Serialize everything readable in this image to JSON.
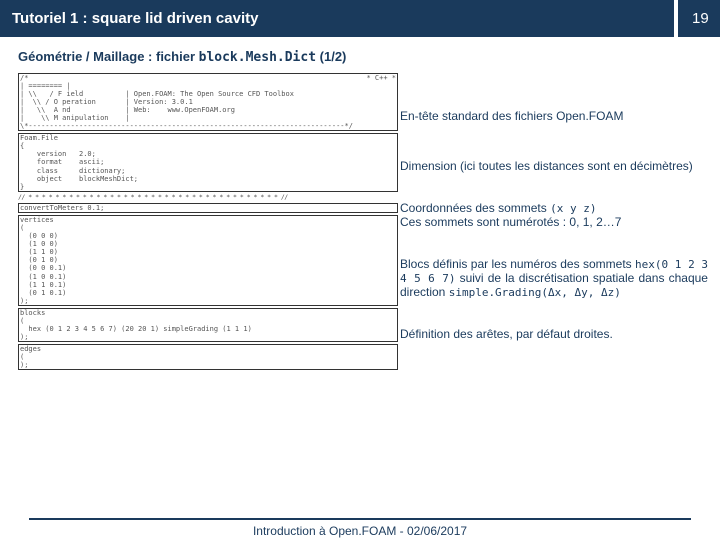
{
  "header": {
    "title": "Tutoriel 1 : square lid driven cavity",
    "page": "19"
  },
  "subtitle": {
    "prefix": "Géométrie / Maillage : fichier ",
    "code": "block.Mesh.Dict",
    "suffix": " (1/2)"
  },
  "code": {
    "topbar_left": "/*",
    "topbar_right": "* C++ *",
    "banner": "| ======== |\n| \\\\   / F ield          | Open.FOAM: The Open Source CFD Toolbox\n|  \\\\ / O peration       | Version: 3.0.1\n|   \\\\  A nd             | Web:    www.OpenFOAM.org\n|    \\\\ M anipulation    |\n\\*---------------------------------------------------------------------------*/",
    "foamfile": "Foam.File\n{\n    version   2.0;\n    format    ascii;\n    class     dictionary;\n    object    blockMeshDict;\n}",
    "stars_line": "// * * * * * * * * * * * * * * * * * * * * * * * * * * * * * * * * * * * * * //",
    "convert": "convertToMeters 0.1;",
    "vertices": "vertices\n(\n  (0 0 0)\n  (1 0 0)\n  (1 1 0)\n  (0 1 0)\n  (0 0 0.1)\n  (1 0 0.1)\n  (1 1 0.1)\n  (0 1 0.1)\n);",
    "blocks": "blocks\n(\n  hex (0 1 2 3 4 5 6 7) (20 20 1) simpleGrading (1 1 1)\n);",
    "edges": "edges\n(\n);"
  },
  "comments": {
    "c1": "En-tête standard des fichiers Open.FOAM",
    "c2": "Dimension (ici toutes les distances sont en décimètres)",
    "c3_a": "Coordonnées des sommets ",
    "c3_code": "(x y z)",
    "c3_b": "Ces sommets sont numérotés : 0, 1, 2…7",
    "c4_a": "Blocs définis par les numéros des sommets ",
    "c4_code1": "hex(0 1 2 3 4 5 6 7)",
    "c4_b": " suivi de la discrétisation spatiale dans chaque direction ",
    "c4_code2": "simple.Grading(Δx, Δy, Δz)",
    "c5": "Définition des arêtes, par défaut droites."
  },
  "footer": "Introduction à Open.FOAM - 02/06/2017"
}
